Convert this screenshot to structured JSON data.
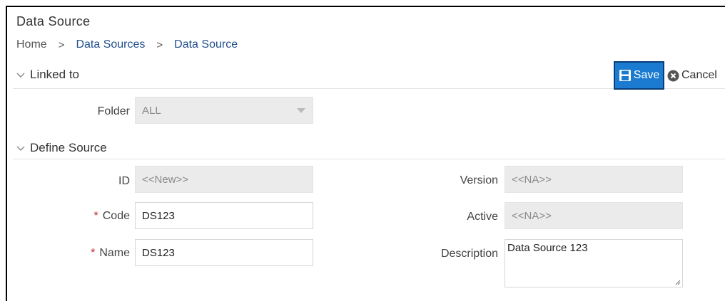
{
  "page": {
    "title": "Data Source"
  },
  "breadcrumb": {
    "home": "Home",
    "level1": "Data Sources",
    "level2": "Data Source",
    "separator": ">"
  },
  "toolbar": {
    "save_label": "Save",
    "cancel_label": "Cancel"
  },
  "linked_to": {
    "title": "Linked to",
    "folder_label": "Folder",
    "folder_value": "ALL"
  },
  "define_source": {
    "title": "Define Source",
    "id_label": "ID",
    "id_value": "<<New>>",
    "code_label": "Code",
    "code_value": "DS123",
    "name_label": "Name",
    "name_value": "DS123",
    "version_label": "Version",
    "version_value": "<<NA>>",
    "active_label": "Active",
    "active_value": "<<NA>>",
    "description_label": "Description",
    "description_value": "Data Source 123",
    "required_marker": "*"
  },
  "colors": {
    "accent": "#1a7bd0",
    "link": "#1f4e8c",
    "required": "#c0262d",
    "readonly_bg": "#ebebeb"
  },
  "icons": [
    "chevron-down-icon",
    "save-icon",
    "cancel-icon",
    "dropdown-caret-icon",
    "resize-grip-icon"
  ]
}
